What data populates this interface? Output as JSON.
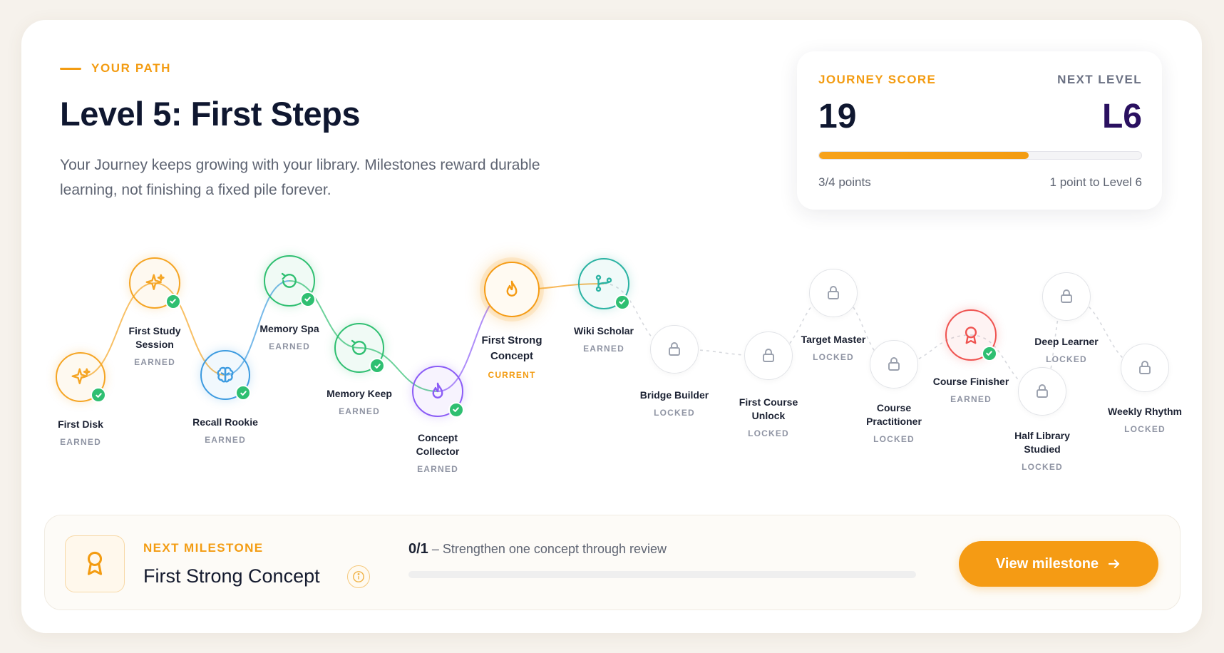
{
  "header": {
    "eyebrow": "YOUR PATH",
    "title": "Level 5: First Steps",
    "description": "Your Journey keeps growing with your library. Milestones reward durable learning, not finishing a fixed pile forever."
  },
  "score": {
    "label": "JOURNEY SCORE",
    "value": "19",
    "next_label": "NEXT LEVEL",
    "next_value": "L6",
    "progress_fraction": 0.65,
    "points_text": "3/4 points",
    "to_next_text": "1 point to Level 6"
  },
  "path": {
    "nodes": [
      {
        "name": "First Disk",
        "status": "EARNED",
        "state": "earned",
        "icon": "sparkle-icon",
        "color": "#f5a524"
      },
      {
        "name": "First Study Session",
        "status": "EARNED",
        "state": "earned",
        "icon": "sparkle-icon",
        "color": "#f5a524"
      },
      {
        "name": "Recall Rookie",
        "status": "EARNED",
        "state": "earned",
        "icon": "brain-icon",
        "color": "#3d9be0"
      },
      {
        "name": "Memory Spa",
        "status": "EARNED",
        "state": "earned",
        "icon": "refresh-icon",
        "color": "#2fbf71"
      },
      {
        "name": "Memory Keep",
        "status": "EARNED",
        "state": "earned",
        "icon": "refresh-icon",
        "color": "#2fbf71"
      },
      {
        "name": "Concept Collector",
        "status": "EARNED",
        "state": "earned",
        "icon": "flame-icon",
        "color": "#8b5cf6"
      },
      {
        "name": "First Strong Concept",
        "status": "CURRENT",
        "state": "current",
        "icon": "flame-icon",
        "color": "#f59b14"
      },
      {
        "name": "Wiki Scholar",
        "status": "EARNED",
        "state": "earned",
        "icon": "branch-icon",
        "color": "#2bb3a3"
      },
      {
        "name": "Bridge Builder",
        "status": "LOCKED",
        "state": "locked",
        "icon": "lock-icon",
        "color": "#9aa0ad"
      },
      {
        "name": "First Course Unlock",
        "status": "LOCKED",
        "state": "locked",
        "icon": "lock-icon",
        "color": "#9aa0ad"
      },
      {
        "name": "Target Master",
        "status": "LOCKED",
        "state": "locked",
        "icon": "lock-icon",
        "color": "#9aa0ad"
      },
      {
        "name": "Course Practitioner",
        "status": "LOCKED",
        "state": "locked",
        "icon": "lock-icon",
        "color": "#9aa0ad"
      },
      {
        "name": "Course Finisher",
        "status": "EARNED",
        "state": "earned",
        "icon": "award-icon",
        "color": "#ef5350"
      },
      {
        "name": "Half Library Studied",
        "status": "LOCKED",
        "state": "locked",
        "icon": "lock-icon",
        "color": "#9aa0ad"
      },
      {
        "name": "Deep Learner",
        "status": "LOCKED",
        "state": "locked",
        "icon": "lock-icon",
        "color": "#9aa0ad"
      },
      {
        "name": "Weekly Rhythm",
        "status": "LOCKED",
        "state": "locked",
        "icon": "lock-icon",
        "color": "#9aa0ad"
      }
    ]
  },
  "next_milestone": {
    "label": "NEXT MILESTONE",
    "title": "First Strong Concept",
    "progress_count": "0/1",
    "progress_desc": " – Strengthen one concept through review",
    "progress_fraction": 0,
    "button_label": "View milestone",
    "icon": "award-icon"
  }
}
